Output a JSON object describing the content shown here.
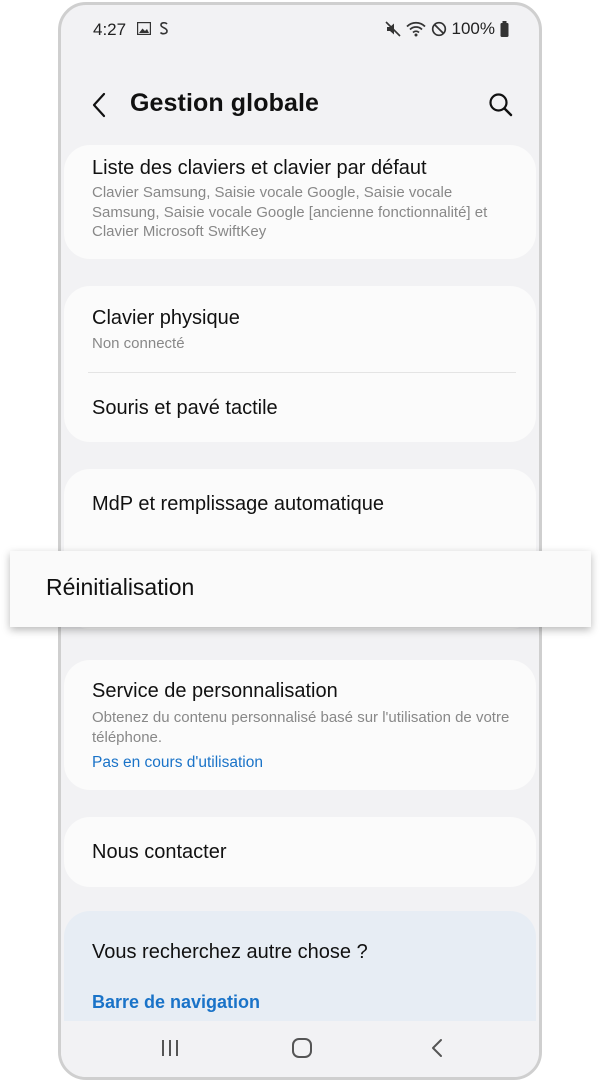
{
  "status_bar": {
    "time": "4:27",
    "battery": "100%",
    "icons_left": [
      "gallery-icon",
      "samsung-pay-icon"
    ],
    "icons_right": [
      "mute-icon",
      "wifi-icon",
      "do-not-disturb-icon",
      "battery-icon"
    ]
  },
  "header": {
    "title": "Gestion globale",
    "back_icon": "chevron-left-icon",
    "search_icon": "search-icon"
  },
  "items": {
    "keyboards": {
      "title": "Liste des claviers et clavier par défaut",
      "subtitle": "Clavier Samsung, Saisie vocale Google, Saisie vocale Samsung, Saisie vocale Google [ancienne fonctionnalité] et Clavier Microsoft SwiftKey"
    },
    "physical_keyboard": {
      "title": "Clavier physique",
      "subtitle": "Non connecté"
    },
    "mouse": {
      "title": "Souris et pavé tactile"
    },
    "passwords": {
      "title": "MdP et remplissage automatique"
    },
    "reset": {
      "title": "Réinitialisation"
    },
    "personalization": {
      "title": "Service de personnalisation",
      "subtitle": "Obtenez du contenu personnalisé basé sur l'utilisation de votre téléphone.",
      "status": "Pas en cours d'utilisation"
    },
    "contact": {
      "title": "Nous contacter"
    }
  },
  "looking_for": {
    "title": "Vous recherchez autre chose ?",
    "link": "Barre de navigation"
  },
  "nav_bar": {
    "icons": [
      "recents-icon",
      "home-icon",
      "back-icon"
    ]
  },
  "colors": {
    "background": "#f2f2f4",
    "card": "#fbfbfb",
    "accent": "#1a73c8",
    "secondary_text": "#888888",
    "search_card": "#e7edf4"
  }
}
